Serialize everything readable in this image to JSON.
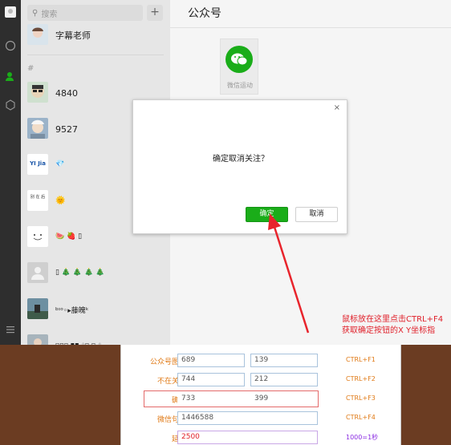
{
  "search": {
    "placeholder": "搜索",
    "add_label": "+"
  },
  "list": {
    "section_letter": "#",
    "items": [
      {
        "name": "字幕老师"
      },
      {
        "name": "4840"
      },
      {
        "name": "9527"
      },
      {
        "name": "💎"
      },
      {
        "name": "🌞"
      },
      {
        "name": "🍉 🍓 ▯"
      },
      {
        "name": "▯ 🎄 🎄 🎄 🎄"
      },
      {
        "name": "ᵇᶦᵒ◦▸藤魄ᵏ"
      },
      {
        "name": "▫▫▫ ▪▪ ◦▫ ▫ ◦"
      }
    ],
    "avatar_texts": {
      "yijia": "YI Jia",
      "handwriting": "别 在 后"
    }
  },
  "main": {
    "title": "公众号",
    "card_label": "微信运动"
  },
  "modal": {
    "close": "×",
    "message": "确定取消关注？",
    "ok_label": "确定",
    "cancel_label": "取消"
  },
  "annotation": {
    "line1": "鼠标放在这里点击CTRL+F4",
    "line2": "获取确定按钮的X Y坐标指"
  },
  "tool": {
    "rows": [
      {
        "label": "公众号图标:",
        "x": "689",
        "y": "139",
        "key": "CTRL+F1"
      },
      {
        "label": "不在关注:",
        "x": "744",
        "y": "212",
        "key": "CTRL+F2"
      },
      {
        "label": "确定:",
        "x": "733",
        "y": "399",
        "key": "CTRL+F3"
      },
      {
        "label": "微信句柄:",
        "value": "1446588",
        "key": "CTRL+F4"
      },
      {
        "label": "延迟:",
        "value": "2500",
        "key": "1000=1秒"
      }
    ]
  },
  "colors": {
    "accent": "#1aad19",
    "annotation": "#e0202a",
    "tool_label": "#e07a16"
  }
}
